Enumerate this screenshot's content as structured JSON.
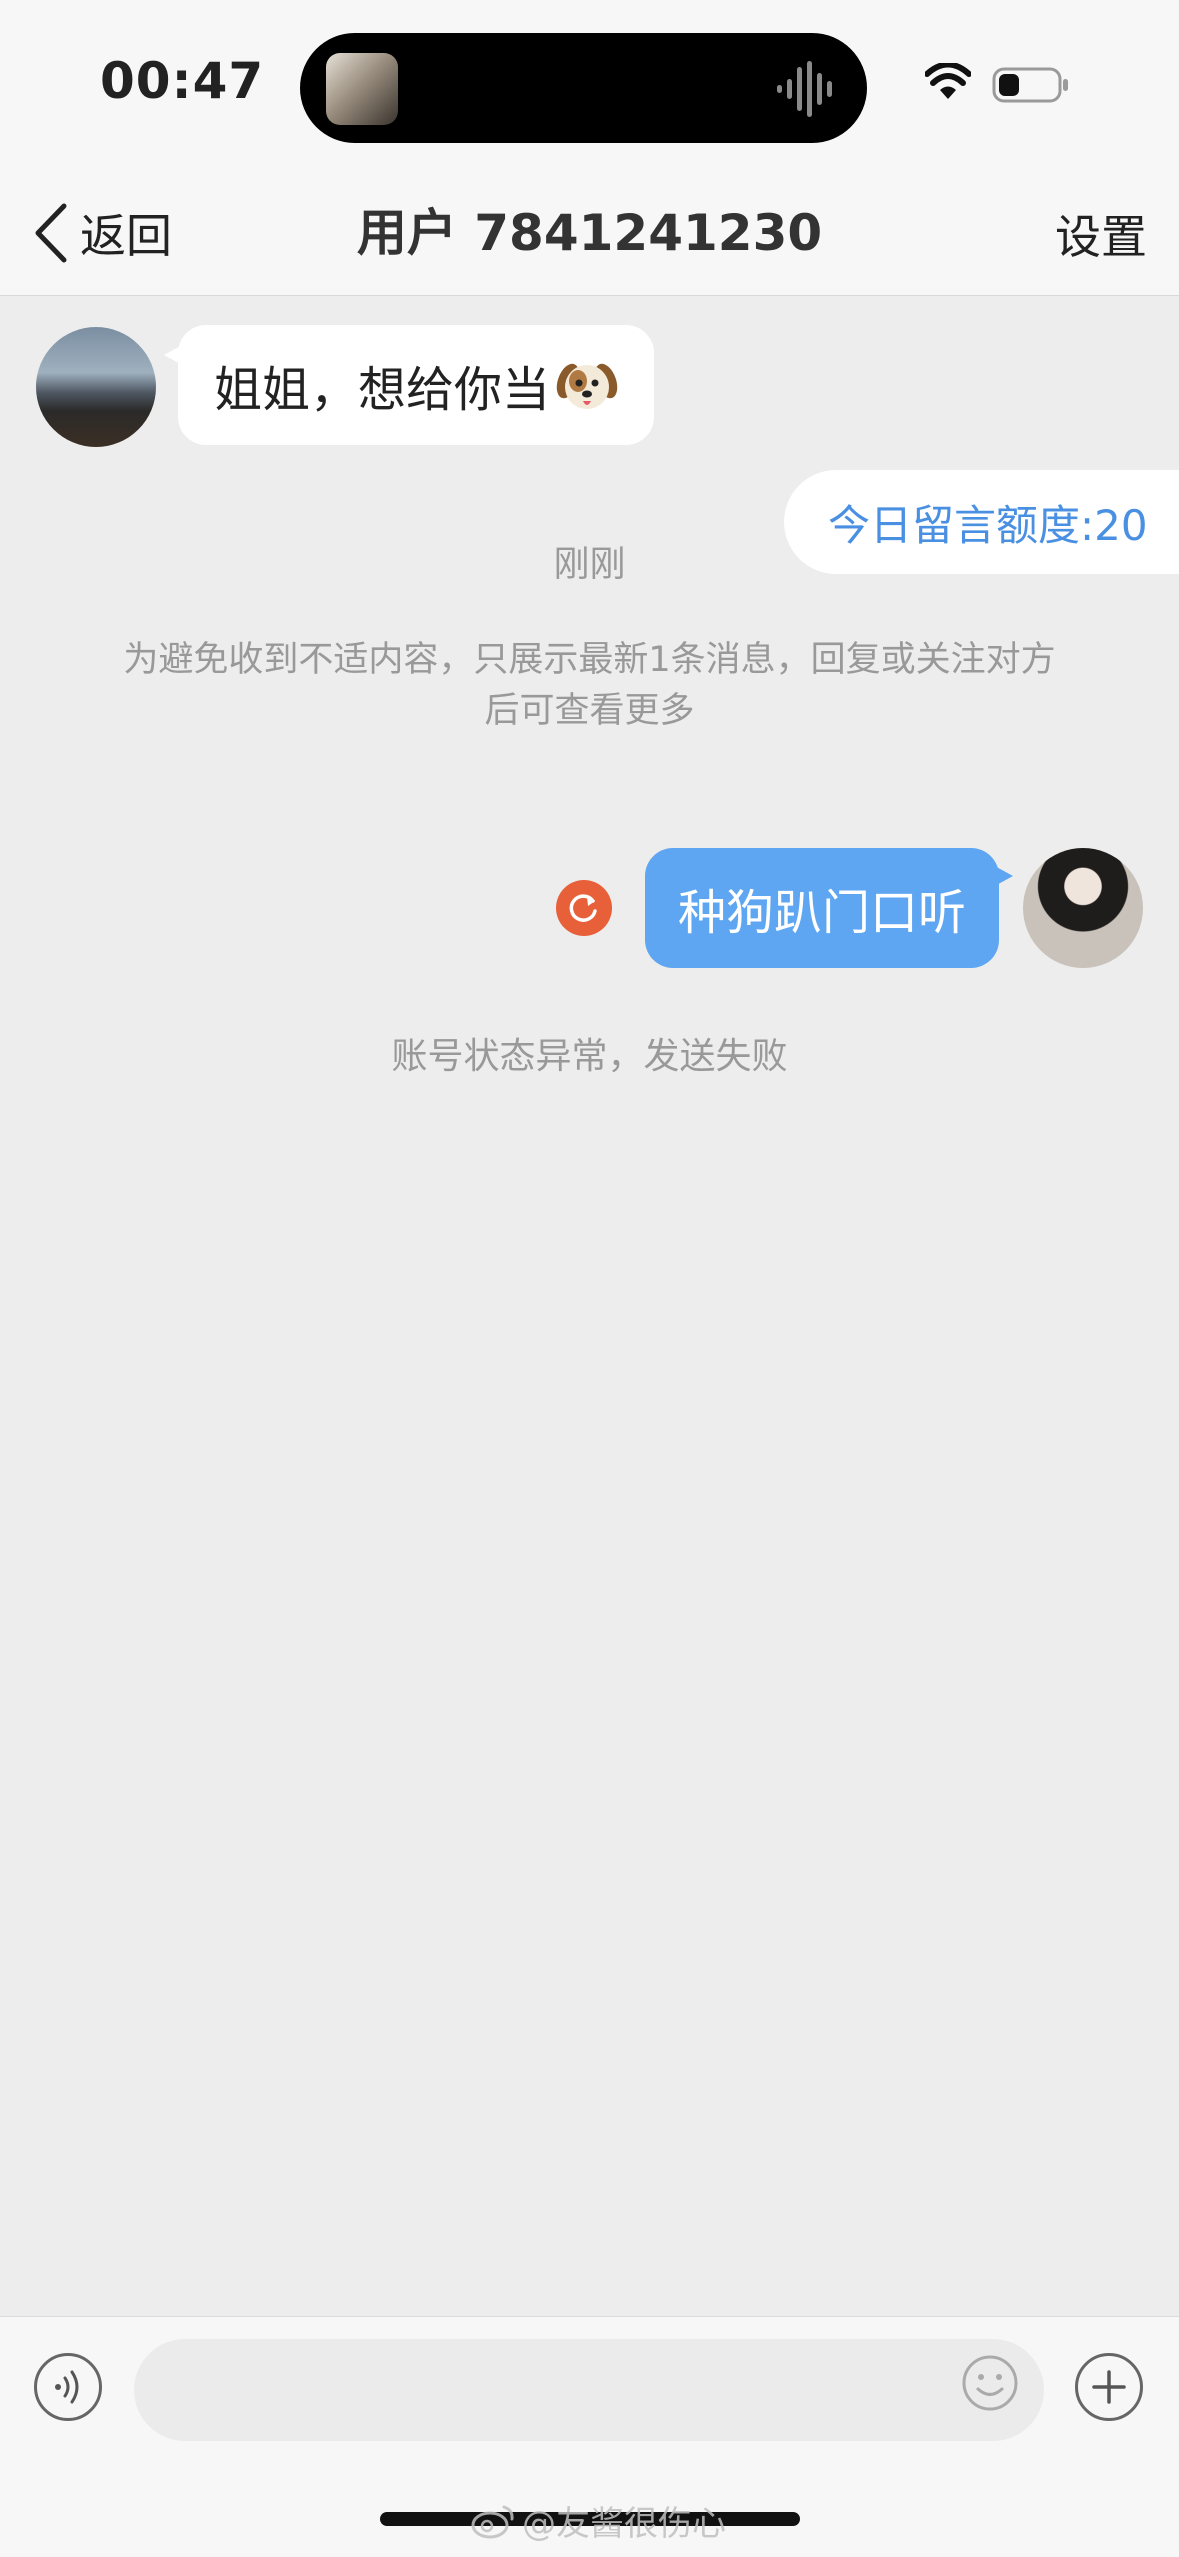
{
  "status_bar": {
    "time": "00:47",
    "battery_level": 0.35
  },
  "nav": {
    "back_label": "返回",
    "title": "用户 7841241230",
    "settings_label": "设置"
  },
  "messages": {
    "incoming_text": "姐姐，想给你当",
    "incoming_emoji": "dog-face-icon",
    "quota_label": "今日留言额度:20",
    "timestamp": "刚刚",
    "notice": "为避免收到不适内容，只展示最新1条消息，回复或关注对方后可查看更多",
    "outgoing_text": "种狗趴门口听",
    "send_failed_notice": "账号状态异常，发送失败"
  },
  "input": {
    "value": "",
    "placeholder": ""
  },
  "watermark": {
    "text": "@友酱很伤心"
  },
  "colors": {
    "outgoing_bubble": "#5ea6f2",
    "quota_text": "#4a90e2",
    "retry": "#e8603a",
    "background": "#ededed"
  }
}
